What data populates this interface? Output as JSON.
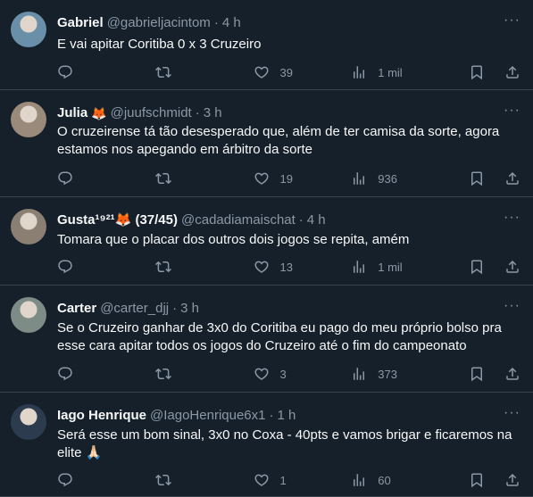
{
  "tweets": [
    {
      "name": "Gabriel",
      "emoji": "",
      "handle": "@gabrieljacintom",
      "time": "4 h",
      "text": [
        "E vai apitar Coritiba 0 x 3 Cruzeiro"
      ],
      "replies": "",
      "retweets": "",
      "likes": "39",
      "views": "1 mil",
      "avatar_color": "#6a8fa8"
    },
    {
      "name": "Julia",
      "emoji": "🦊",
      "handle": "@juufschmidt",
      "time": "3 h",
      "text": [
        "O cruzeirense tá tão desesperado que, além de ter camisa da sorte, agora",
        "estamos nos apegando em árbitro da sorte"
      ],
      "replies": "",
      "retweets": "",
      "likes": "19",
      "views": "936",
      "avatar_color": "#9a8a7a"
    },
    {
      "name": "Gusta¹⁹²¹🦊 (37/45)",
      "emoji": "",
      "handle": "@cadadiamaischat",
      "time": "4 h",
      "text": [
        "Tomara que o placar dos outros dois jogos se repita, amém"
      ],
      "replies": "",
      "retweets": "",
      "likes": "13",
      "views": "1 mil",
      "avatar_color": "#8b7f74"
    },
    {
      "name": "Carter",
      "emoji": "",
      "handle": "@carter_djj",
      "time": "3 h",
      "text": [
        "Se o Cruzeiro ganhar de 3x0 do Coritiba eu pago do meu próprio bolso pra",
        "esse cara apitar todos os jogos do Cruzeiro até o fim do campeonato"
      ],
      "replies": "",
      "retweets": "",
      "likes": "3",
      "views": "373",
      "avatar_color": "#7d8c86"
    },
    {
      "name": "Iago Henrique",
      "emoji": "",
      "handle": "@IagoHenrique6x1",
      "time": "1 h",
      "text": [
        "Será esse um bom sinal, 3x0 no Coxa - 40pts e vamos brigar e ficaremos na",
        "elite 🙏🏻"
      ],
      "replies": "",
      "retweets": "",
      "likes": "1",
      "views": "60",
      "avatar_color": "#2c3b4e"
    }
  ],
  "more_glyph": "···"
}
